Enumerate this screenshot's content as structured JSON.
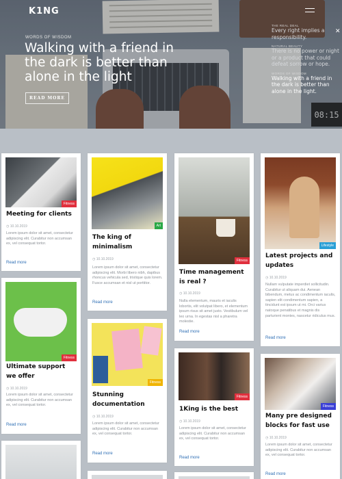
{
  "brand": {
    "logo": "K1NG"
  },
  "hero": {
    "kicker": "WORDS OF WISDOM",
    "title": "Walking with a friend in the dark is better than alone in the light",
    "button": "READ MORE",
    "clock": "08:15"
  },
  "side_list": [
    {
      "kicker": "THE REAL DEAL",
      "title": "Every right implies a responsibility."
    },
    {
      "kicker": "NATURAL BEAUTY",
      "title": "There is no power or night or a product that could defeat sorrow or hope."
    },
    {
      "kicker": "WORDS OF WISDOM",
      "title": "Walking with a friend in the dark is better than alone in the light."
    }
  ],
  "cards": [
    {
      "title": "Meeting for clients",
      "badge": "Fitness",
      "date": "10.10.2019",
      "desc": "Lorem ipsum dolor sit amet, consectetur adipiscing elit. Curabitur non accumsan ex, vel consequat tortor.",
      "more": "Read more"
    },
    {
      "title": "Ultimate support we offer",
      "badge": "Fitness",
      "date": "10.10.2019",
      "desc": "Lorem ipsum dolor sit amet, consectetur adipiscing elit. Curabitur non accumsan ex, vel consequat tortor.",
      "more": "Read more"
    },
    {
      "title": "The king of minimalism",
      "badge": "Art",
      "date": "10.10.2019",
      "desc": "Lorem ipsum dolor sit amet, consectetur adipiscing elit. Morbi libero nibh, dapibus rhoncus vehicula sed, tristique quis lorem. Fusce accumsan et nisl ut porttitor.",
      "more": "Read more"
    },
    {
      "title": "Stunning documentation",
      "badge": "Fitness",
      "date": "10.10.2019",
      "desc": "Lorem ipsum dolor sit amet, consectetur adipiscing elit. Curabitur non accumsan ex, vel consequat tortor.",
      "more": "Read more"
    },
    {
      "title": "Time management is real ?",
      "badge": "Fitness",
      "date": "10.10.2019",
      "desc": "Nulla elementum, mauris et iaculis lobortis, elit volutpat libero, et elementum ipsum risus sit amet justo. Vestibulum vel leo urna. In egestas nisl a pharetra molestie.",
      "more": "Read more"
    },
    {
      "title": "1King is the best",
      "badge": "Fitness",
      "date": "10.10.2019",
      "desc": "Lorem ipsum dolor sit amet, consectetur adipiscing elit. Curabitur non accumsan ex, vel consequat tortor.",
      "more": "Read more"
    },
    {
      "title": "Latest projects and updates",
      "badge": "Lifestyle",
      "date": "10.10.2019",
      "desc": "Nullam vulputate imperdiet sollicitudin. Curabitur ut aliquam dui. Aenean bibendum, metus ac condimentum iaculis, sapien elit condimentum sapien, a tincidunt est ipsum ut mi. Orci varius natoque penatibus et magnis dis parturient montes, nascetur ridiculus mus.",
      "more": "Read more"
    },
    {
      "title": "Many pre designed blocks for fast use",
      "badge": "Fitness",
      "date": "10.10.2019",
      "desc": "Lorem ipsum dolor sit amet, consectetur adipiscing elit. Curabitur non accumsan ex, vel consequat tortor.",
      "more": "Read more"
    }
  ],
  "colors": {
    "fitness": "#e02f3d",
    "art": "#2aa846",
    "lifestyle": "#2a9fd6",
    "link": "#2f6fb5",
    "background": "#b9bfc6"
  }
}
